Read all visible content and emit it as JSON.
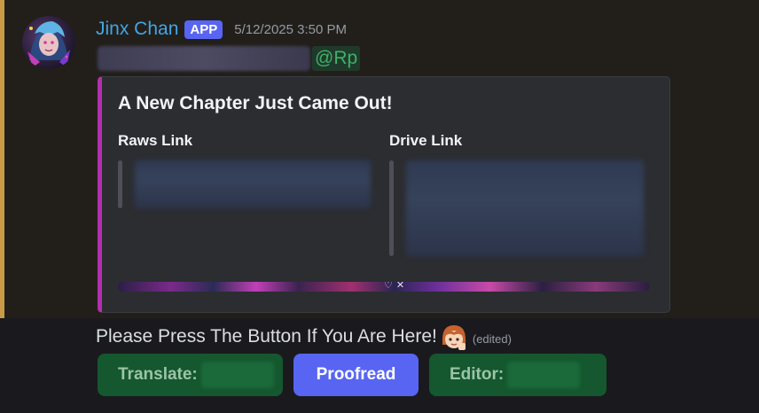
{
  "message": {
    "author": "Jinx Chan",
    "badge": "APP",
    "timestamp": "5/12/2025 3:50 PM",
    "mention": "@Rp",
    "content": "Please Press The Button If You Are Here!",
    "edited_label": "(edited)"
  },
  "embed": {
    "title": "A New Chapter Just Came Out!",
    "accent_color": "#b42fae",
    "fields": [
      {
        "name": "Raws Link"
      },
      {
        "name": "Drive Link"
      }
    ]
  },
  "buttons": [
    {
      "label": "Translate:",
      "style": "success"
    },
    {
      "label": "Proofread",
      "style": "primary"
    },
    {
      "label": "Editor:",
      "style": "success"
    }
  ],
  "colors": {
    "username": "#44a5e3",
    "badge": "#5865f2",
    "mention": "#3fb06a",
    "highlight_bar": "#c99a45"
  }
}
